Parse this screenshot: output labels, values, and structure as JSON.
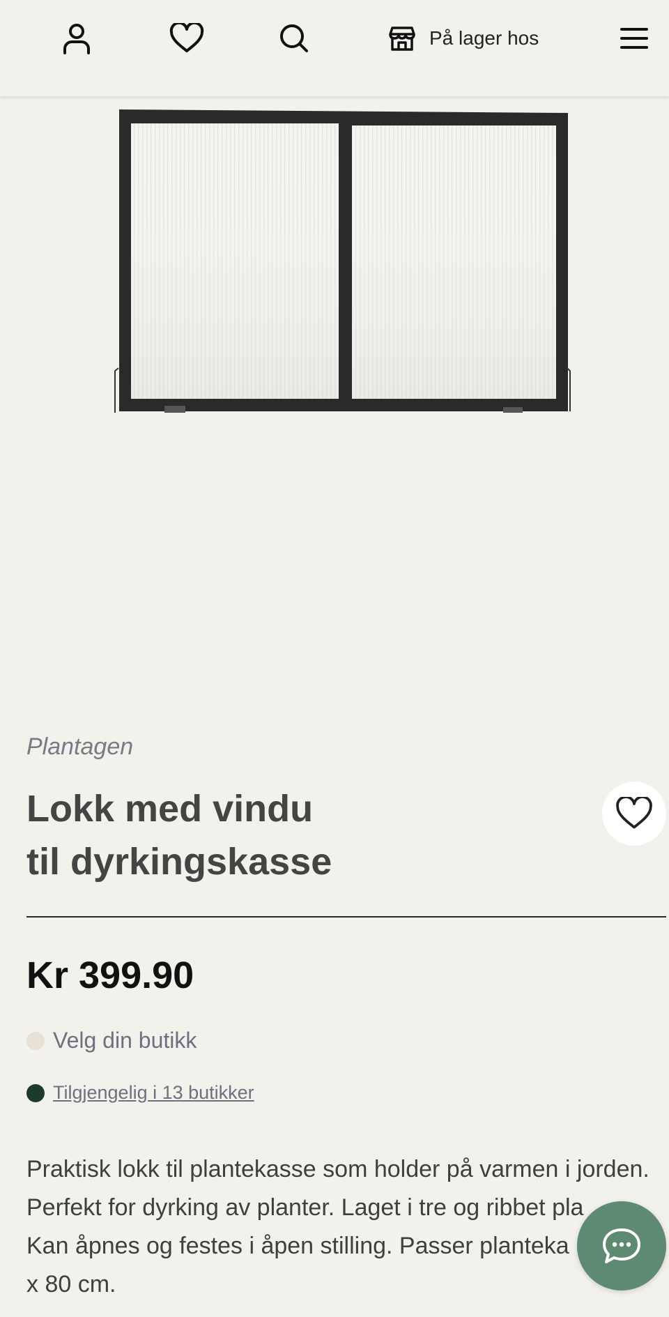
{
  "header": {
    "icons": [
      "user-icon",
      "heart-icon",
      "search-icon",
      "store-icon",
      "menu-icon"
    ],
    "store_label": "På lager hos"
  },
  "product": {
    "brand": "Plantagen",
    "title_lines": [
      "Lokk med vindu",
      "til dyrkingskasse"
    ],
    "price": "Kr 399.90",
    "store_select_label": "Velg din butikk",
    "availability_label": "Tilgjengelig i 13 butikker",
    "description_lines": [
      "Praktisk lokk til plantekasse som holder på varmen i jorden.",
      "Perfekt for dyrking av planter. Laget i tre og ribbet pla",
      "Kan åpnes og festes i åpen stilling. Passer planteka",
      "x 80 cm."
    ]
  },
  "colors": {
    "background": "#f3f1ec",
    "available_dot": "#1e3a2b",
    "store_dot": "#e8e1d7",
    "chat_button": "#5e8a72"
  }
}
